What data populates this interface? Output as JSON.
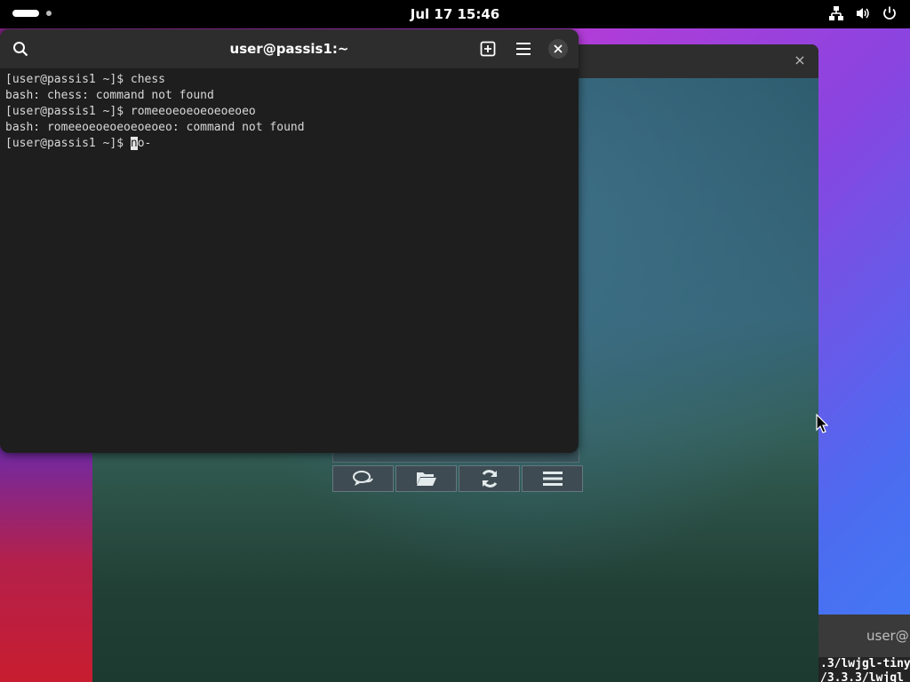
{
  "topbar": {
    "clock": "Jul 17  15:46",
    "icons": [
      "activities-pill",
      "workspace-dot",
      "network-icon",
      "volume-icon",
      "power-icon"
    ]
  },
  "terminal": {
    "title": "user@passis1:~",
    "buttons": [
      "search-icon",
      "new-tab-icon",
      "menu-icon",
      "close-icon"
    ],
    "lines": [
      "[user@passis1 ~]$ chess",
      "bash: chess: command not found",
      "[user@passis1 ~]$ romeeoeoeoeoeoeoeo",
      "bash: romeeoeoeoeoeoeoeo: command not found"
    ],
    "prompt": "[user@passis1 ~]$ ",
    "cursor_char": "n",
    "typed_rest": "o-"
  },
  "image_viewer": {
    "close_label": "×",
    "controls": [
      "chat-icon",
      "folder-open-icon",
      "refresh-icon",
      "menu-icon"
    ]
  },
  "third_window": {
    "title": "user@p",
    "line1": ".3/lwjgl-tiny",
    "line2": "/3.3.3/lwjgl"
  },
  "colors": {
    "terminal_bg": "#1e1e1e",
    "terminal_header": "#2d2d2d",
    "topbar": "#000000"
  }
}
